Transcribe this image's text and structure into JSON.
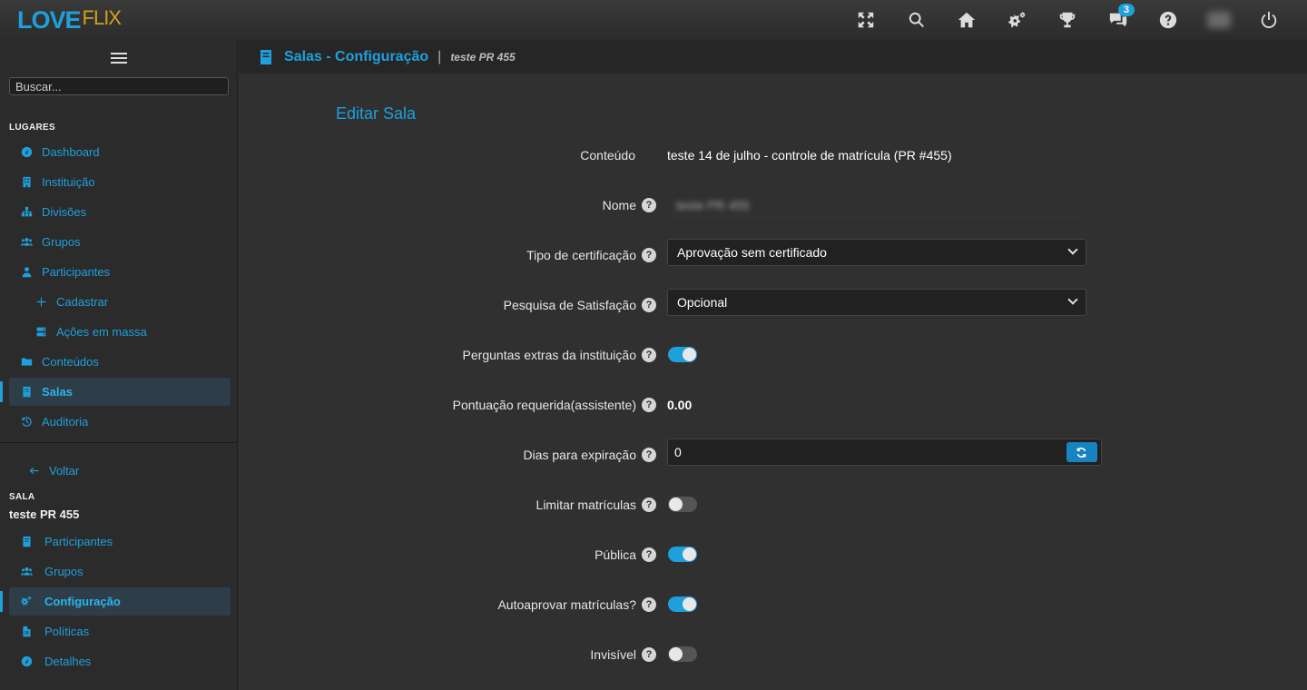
{
  "app": {
    "logo_main": "LOVE",
    "logo_sub": "FLIX"
  },
  "topbar": {
    "notifications_count": "3"
  },
  "sidebar": {
    "search_placeholder": "Buscar...",
    "section_places": "LUGARES",
    "items": [
      {
        "label": "Dashboard",
        "icon": "dashboard-icon"
      },
      {
        "label": "Instituição",
        "icon": "building-icon"
      },
      {
        "label": "Divisões",
        "icon": "sitemap-icon"
      },
      {
        "label": "Grupos",
        "icon": "users-icon"
      },
      {
        "label": "Participantes",
        "icon": "user-icon"
      },
      {
        "label": "Cadastrar",
        "icon": "plus-icon"
      },
      {
        "label": "Ações em massa",
        "icon": "server-icon"
      },
      {
        "label": "Conteúdos",
        "icon": "folder-icon"
      },
      {
        "label": "Salas",
        "icon": "book-icon",
        "active": true
      },
      {
        "label": "Auditoria",
        "icon": "history-icon"
      }
    ],
    "back_label": "Voltar",
    "section_room": "SALA",
    "room_name": "teste PR 455",
    "room_items": [
      {
        "label": "Participantes",
        "icon": "book-icon"
      },
      {
        "label": "Grupos",
        "icon": "users-icon"
      },
      {
        "label": "Configuração",
        "icon": "gears-icon",
        "active": true
      },
      {
        "label": "Políticas",
        "icon": "file-icon"
      },
      {
        "label": "Detalhes",
        "icon": "dashboard-icon"
      }
    ]
  },
  "header": {
    "title": "Salas - Configuração",
    "breadcrumb": "teste PR 455"
  },
  "form": {
    "title": "Editar Sala",
    "content_label": "Conteúdo",
    "content_value": "teste 14 de julho - controle de matrícula (PR #455)",
    "name_label": "Nome",
    "name_value": "teste PR 455",
    "cert_label": "Tipo de certificação",
    "cert_value": "Aprovação sem certificado",
    "survey_label": "Pesquisa de Satisfação",
    "survey_value": "Opcional",
    "extra_questions_label": "Perguntas extras da instituição",
    "extra_questions_on": true,
    "score_label": "Pontuação requerida(assistente)",
    "score_value": "0.00",
    "expiry_label": "Dias para expiração",
    "expiry_value": "0",
    "limit_label": "Limitar matrículas",
    "limit_on": false,
    "public_label": "Pública",
    "public_on": true,
    "autoapprove_label": "Autoaprovar matrículas?",
    "autoapprove_on": true,
    "invisible_label": "Invisível",
    "invisible_on": false,
    "help_glyph": "?"
  }
}
